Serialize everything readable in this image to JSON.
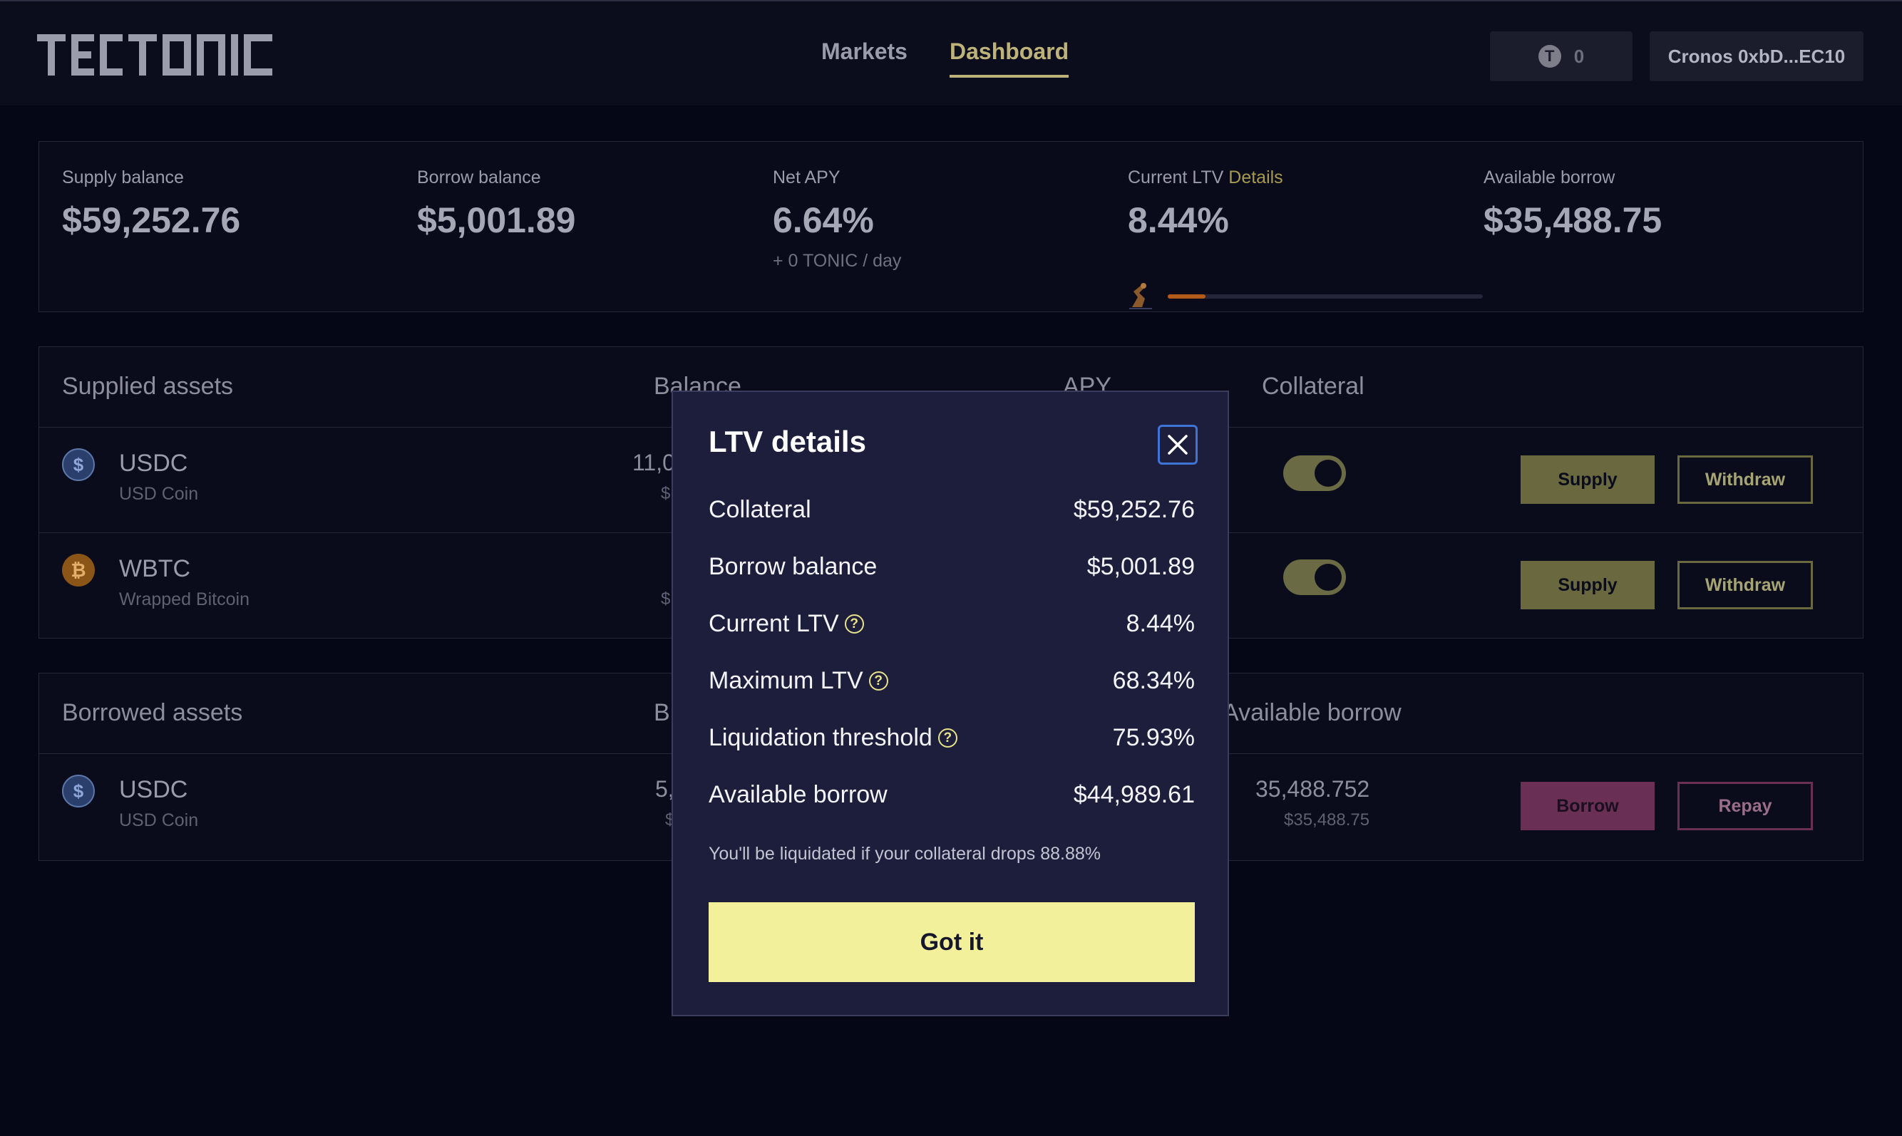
{
  "header": {
    "logo": "TECTONIC",
    "nav": [
      {
        "label": "Markets"
      },
      {
        "label": "Dashboard"
      }
    ],
    "tonic_count": "0",
    "wallet_label": "Cronos 0xbD...EC10"
  },
  "stats": {
    "supply_balance": {
      "label": "Supply balance",
      "value": "$59,252.76"
    },
    "borrow_balance": {
      "label": "Borrow balance",
      "value": "$5,001.89"
    },
    "net_apy": {
      "label": "Net APY",
      "value": "6.64%",
      "sub": "+ 0 TONIC / day"
    },
    "current_ltv": {
      "label": "Current LTV",
      "link": "Details",
      "value": "8.44%",
      "progress_fraction": 0.12
    },
    "available_borrow": {
      "label": "Available borrow",
      "value": "$35,488.75"
    }
  },
  "supplied": {
    "title": "Supplied assets",
    "col_balance": "Balance",
    "col_apy": "APY",
    "col_collateral": "Collateral",
    "rows": [
      {
        "symbol": "USDC",
        "name": "USD Coin",
        "balance_partial": "11,0",
        "balance_sub_partial": "$",
        "collateral_on": true,
        "supply_label": "Supply",
        "withdraw_label": "Withdraw"
      },
      {
        "symbol": "WBTC",
        "name": "Wrapped Bitcoin",
        "balance_sub_partial": "$",
        "collateral_on": true,
        "supply_label": "Supply",
        "withdraw_label": "Withdraw"
      }
    ]
  },
  "borrowed": {
    "title": "Borrowed assets",
    "col_balance_partial": "B",
    "col_available": "Available borrow",
    "rows": [
      {
        "symbol": "USDC",
        "name": "USD Coin",
        "balance_partial": "5,",
        "balance_sub_partial": "$",
        "available": "35,488.752",
        "available_sub": "$35,488.75",
        "borrow_label": "Borrow",
        "repay_label": "Repay"
      }
    ]
  },
  "modal": {
    "title": "LTV details",
    "rows": [
      {
        "label": "Collateral",
        "value": "$59,252.76"
      },
      {
        "label": "Borrow balance",
        "value": "$5,001.89"
      },
      {
        "label": "Current LTV",
        "value": "8.44%"
      },
      {
        "label": "Maximum LTV",
        "value": "68.34%"
      },
      {
        "label": "Liquidation threshold",
        "value": "75.93%"
      },
      {
        "label": "Available borrow",
        "value": "$44,989.61"
      }
    ],
    "note": "You'll be liquidated if your collateral drops 88.88%",
    "button": "Got it"
  },
  "icons": {
    "coin_glyph": "T",
    "usdc_glyph": "$",
    "wbtc_glyph": "₿",
    "help_glyph": "?"
  },
  "colors": {
    "accent": "#bdb27a",
    "modal_bg": "#1d1e3c",
    "got_it": "#f2f09b",
    "borrow": "#6a2f55",
    "ltv_bar": "#b25a1a"
  }
}
